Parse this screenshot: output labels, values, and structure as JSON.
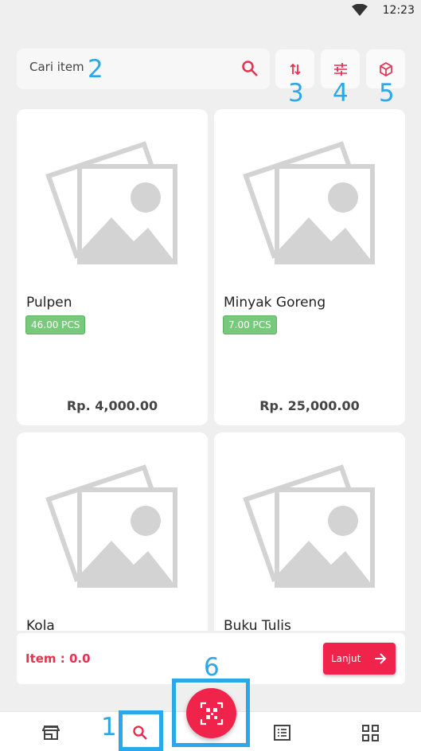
{
  "status_bar": {
    "time": "12:23"
  },
  "search": {
    "placeholder": "Cari item"
  },
  "toolbar": {
    "sort_icon": "sort-arrows-icon",
    "filter_icon": "sliders-icon",
    "package_icon": "cube-icon"
  },
  "annotations": [
    "1",
    "2",
    "3",
    "4",
    "5",
    "6"
  ],
  "products": [
    {
      "name": "Pulpen",
      "stock": "46.00 PCS",
      "price": "Rp. 4,000.00"
    },
    {
      "name": "Minyak Goreng",
      "stock": "7.00 PCS",
      "price": "Rp. 25,000.00"
    },
    {
      "name": "Kola",
      "stock": "",
      "price": ""
    },
    {
      "name": "Buku Tulis",
      "stock": "",
      "price": ""
    }
  ],
  "cart": {
    "label": "Item : 0.0",
    "next_label": "Lanjut"
  },
  "nav": {
    "items": [
      "store-icon",
      "search-icon",
      "qr-scan-icon",
      "list-icon",
      "grid-icon"
    ],
    "accent": "#f0234b"
  },
  "colors": {
    "accent": "#f0234b",
    "stock_badge": "#79c97c",
    "annotation": "#2aa8ea"
  }
}
